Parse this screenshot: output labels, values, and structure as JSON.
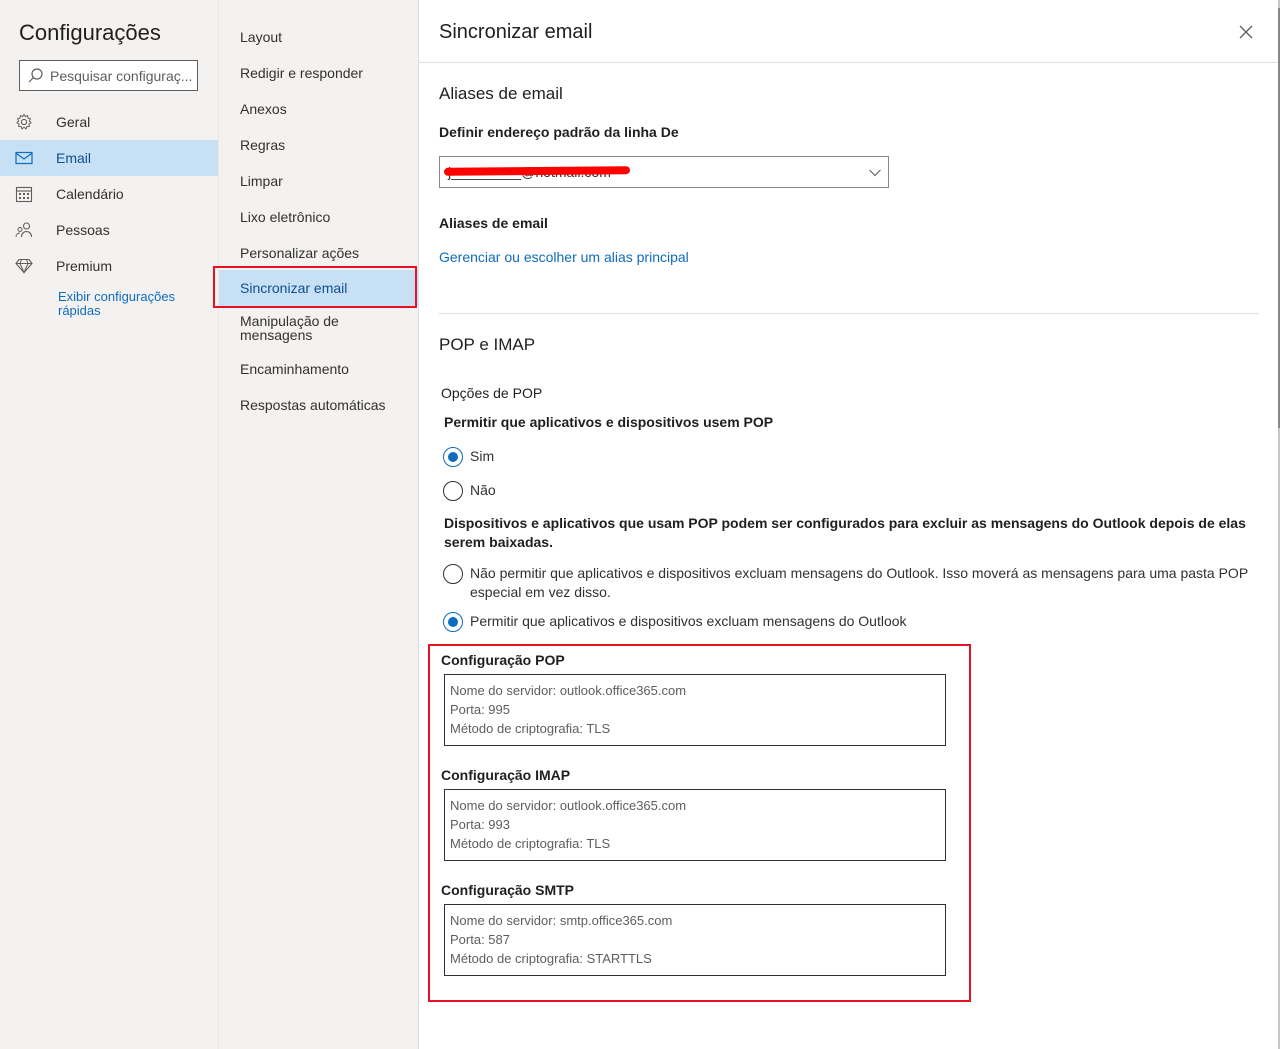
{
  "settings": {
    "title": "Configurações",
    "search_placeholder": "Pesquisar configuraç...",
    "nav": [
      {
        "label": "Geral",
        "icon": "gear-icon",
        "active": false
      },
      {
        "label": "Email",
        "icon": "mail-icon",
        "active": true
      },
      {
        "label": "Calendário",
        "icon": "calendar-icon",
        "active": false
      },
      {
        "label": "Pessoas",
        "icon": "people-icon",
        "active": false
      },
      {
        "label": "Premium",
        "icon": "diamond-icon",
        "active": false
      }
    ],
    "quick_settings_link": "Exibir configurações rápidas"
  },
  "email_menu": {
    "items": [
      {
        "label": "Layout"
      },
      {
        "label": "Redigir e responder"
      },
      {
        "label": "Anexos"
      },
      {
        "label": "Regras"
      },
      {
        "label": "Limpar"
      },
      {
        "label": "Lixo eletrônico"
      },
      {
        "label": "Personalizar ações"
      },
      {
        "label": "Sincronizar email",
        "active": true
      },
      {
        "label": "Manipulação de mensagens"
      },
      {
        "label": "Encaminhamento"
      },
      {
        "label": "Respostas automáticas"
      }
    ]
  },
  "panel": {
    "title": "Sincronizar email",
    "aliases": {
      "section_title": "Aliases de email",
      "default_from_label": "Definir endereço padrão da linha De",
      "default_from_value": "j_________@hotmail.com",
      "aliases_label": "Aliases de email",
      "manage_link": "Gerenciar ou escolher um alias principal"
    },
    "pop_imap": {
      "section_title": "POP e IMAP",
      "pop_options_label": "Opções de POP",
      "allow_pop_question": "Permitir que aplicativos e dispositivos usem POP",
      "allow_pop_yes": "Sim",
      "allow_pop_no": "Não",
      "allow_pop_selected": "Sim",
      "delete_description": "Dispositivos e aplicativos que usam POP podem ser configurados para excluir as mensagens do Outlook depois de elas serem baixadas.",
      "delete_option_deny": "Não permitir que aplicativos e dispositivos excluam mensagens do Outlook. Isso moverá as mensagens para uma pasta POP especial em vez disso.",
      "delete_option_allow": "Permitir que aplicativos e dispositivos excluam mensagens do Outlook",
      "delete_selected": "allow"
    },
    "configs": [
      {
        "title": "Configuração POP",
        "server": "Nome do servidor: outlook.office365.com",
        "port": "Porta: 995",
        "encryption": "Método de criptografia: TLS"
      },
      {
        "title": "Configuração IMAP",
        "server": "Nome do servidor: outlook.office365.com",
        "port": "Porta: 993",
        "encryption": "Método de criptografia: TLS"
      },
      {
        "title": "Configuração SMTP",
        "server": "Nome do servidor: smtp.office365.com",
        "port": "Porta: 587",
        "encryption": "Método de criptografia: STARTTLS"
      }
    ]
  },
  "colors": {
    "accent": "#0f6cbd",
    "highlight": "#e81123",
    "selected_bg": "#c7e0f4"
  }
}
